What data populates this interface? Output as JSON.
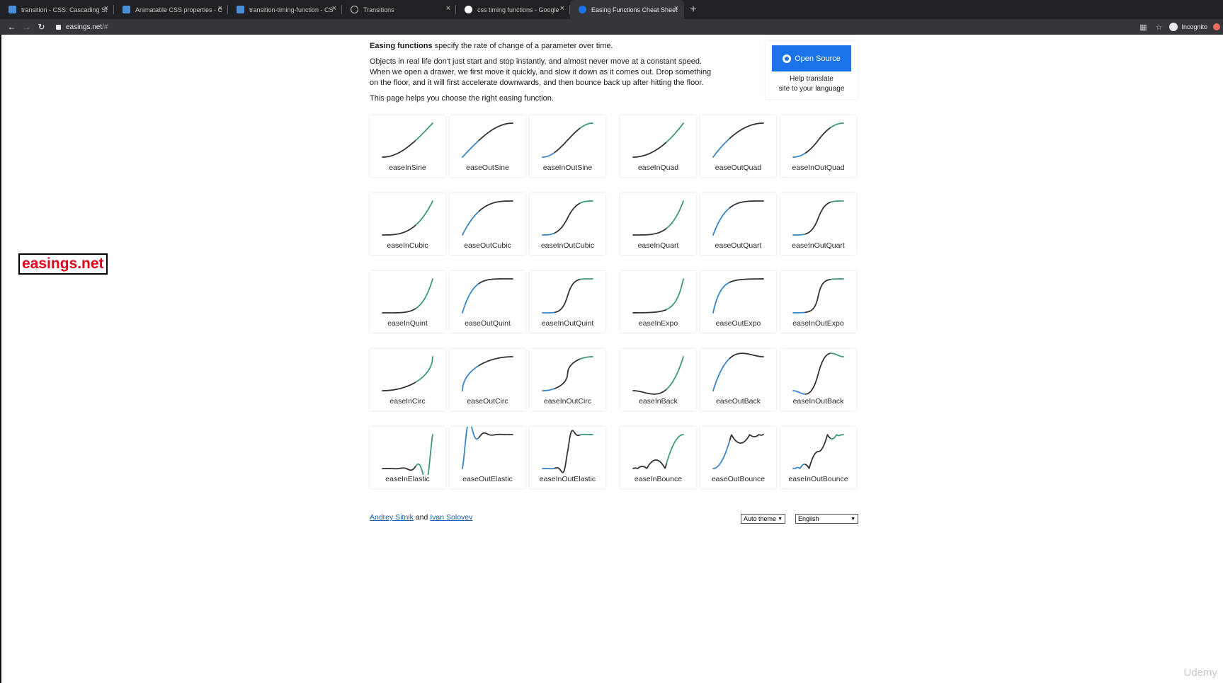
{
  "browser": {
    "tabs": [
      {
        "title": "transition - CSS: Cascading St",
        "icon": "mdn-icon",
        "active": false
      },
      {
        "title": "Animatable CSS properties - C",
        "icon": "mdn-icon",
        "active": false
      },
      {
        "title": "transition-timing-function - CS",
        "icon": "mdn-icon",
        "active": false
      },
      {
        "title": "Transitions",
        "icon": "globe-icon",
        "active": false
      },
      {
        "title": "css timing functions - Google",
        "icon": "google-icon",
        "active": false
      },
      {
        "title": "Easing Functions Cheat Sheet",
        "icon": "easings-icon",
        "active": true
      }
    ],
    "url_host": "easings.net",
    "url_path": "/#",
    "profile_label": "Incognito"
  },
  "overlay_label": "easings.net",
  "intro": {
    "lead_strong": "Easing functions",
    "lead_rest": " specify the rate of change of a parameter over time.",
    "paragraph": "Objects in real life don't just start and stop instantly, and almost never move at a constant speed. When we open a drawer, we first move it quickly, and slow it down as it comes out. Drop something on the floor, and it will first accelerate downwards, and then bounce back up after hitting the floor.",
    "help": "This page helps you choose the right easing function."
  },
  "open_source": {
    "button_label": "Open Source",
    "help_line1": "Help translate",
    "help_line2": "site to your language"
  },
  "easings": [
    "easeInSine",
    "easeOutSine",
    "easeInOutSine",
    "easeInQuad",
    "easeOutQuad",
    "easeInOutQuad",
    "easeInCubic",
    "easeOutCubic",
    "easeInOutCubic",
    "easeInQuart",
    "easeOutQuart",
    "easeInOutQuart",
    "easeInQuint",
    "easeOutQuint",
    "easeInOutQuint",
    "easeInExpo",
    "easeOutExpo",
    "easeInOutExpo",
    "easeInCirc",
    "easeOutCirc",
    "easeInOutCirc",
    "easeInBack",
    "easeOutBack",
    "easeInOutBack",
    "easeInElastic",
    "easeOutElastic",
    "easeInOutElastic",
    "easeInBounce",
    "easeOutBounce",
    "easeInOutBounce"
  ],
  "colors": {
    "curve_dark": "#333333",
    "curve_blue": "#3a86c8",
    "curve_green": "#3f9a78",
    "accent": "#1a73e8"
  },
  "footer": {
    "author1": "Andrey Sitnik",
    "and": "and",
    "author2": "Ivan Solovev",
    "theme_select": "Auto theme",
    "language_select": "English"
  },
  "udemy_watermark": "Udemy"
}
